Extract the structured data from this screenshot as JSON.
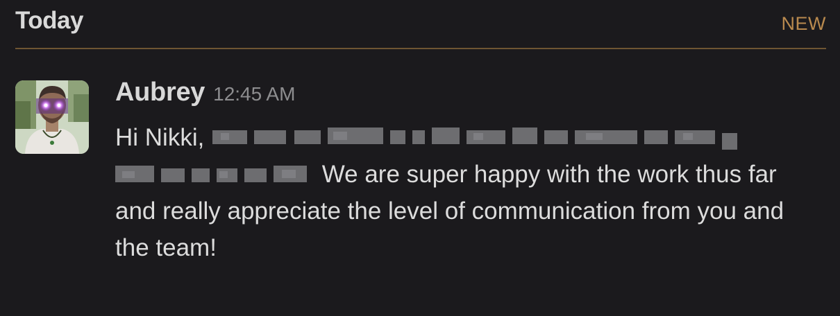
{
  "day_header": {
    "label": "Today",
    "new_badge": "NEW"
  },
  "message": {
    "author": "Aubrey",
    "time": "12:45 AM",
    "greeting": "Hi Nikki,",
    "text": "We are super happy with the work thus far and really appreciate the level of communication from you and the team!"
  },
  "colors": {
    "background": "#1b1a1d",
    "new_accent": "#b98a4e",
    "divider": "#6f5533",
    "text": "#dcdcdc",
    "timestamp": "#8d8d8f"
  },
  "icons": {
    "avatar": "user-photo-avatar"
  }
}
